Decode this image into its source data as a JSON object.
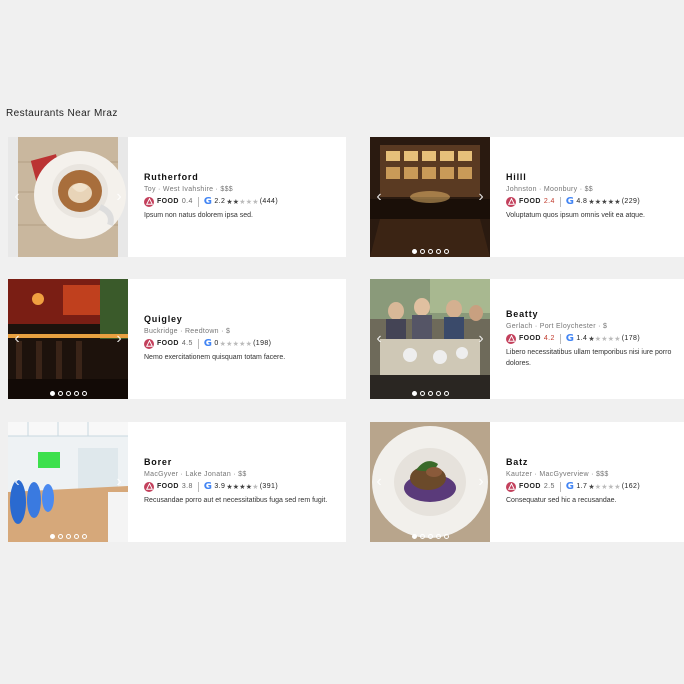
{
  "page": {
    "title": "Restaurants Near Mraz"
  },
  "brand": {
    "food_icon_color": "#c3405c",
    "google_blue": "#4285f4"
  },
  "restaurants": [
    {
      "name": "Rutherford",
      "meta": "Toy · West Ivahshire · $$$",
      "food_label": "FOOD",
      "food_score": "0.4",
      "food_score_style": "normal",
      "google_rating": "2.2",
      "stars": "★★",
      "stars_off": "★★★",
      "review_count": "(444)",
      "description": "Ipsum non natus dolorem ipsa sed.",
      "photo_count": 1,
      "active_photo": 0,
      "photo": "coffee-cup"
    },
    {
      "name": "Hilll",
      "meta": "Johnston · Moonbury · $$",
      "food_label": "FOOD",
      "food_score": "2.4",
      "food_score_style": "red",
      "google_rating": "4.8",
      "stars": "★★★★★",
      "stars_off": "",
      "review_count": "(229)",
      "description": "Voluptatum quos ipsum omnis velit ea atque.",
      "photo_count": 5,
      "active_photo": 0,
      "photo": "bar-interior"
    },
    {
      "name": "Quigley",
      "meta": "Buckridge · Reedtown · $",
      "food_label": "FOOD",
      "food_score": "4.5",
      "food_score_style": "normal",
      "google_rating": "0",
      "stars": "",
      "stars_off": "★★★★★",
      "review_count": "(198)",
      "description": "Nemo exercitationem quisquam totam facere.",
      "photo_count": 5,
      "active_photo": 0,
      "photo": "red-bar"
    },
    {
      "name": "Beatty",
      "meta": "Gerlach · Port Eloychester · $",
      "food_label": "FOOD",
      "food_score": "4.2",
      "food_score_style": "red",
      "google_rating": "1.4",
      "stars": "★",
      "stars_off": "★★★★",
      "review_count": "(178)",
      "description": "Libero necessitatibus ullam temporibus nisi iure porro dolores.",
      "photo_count": 5,
      "active_photo": 0,
      "photo": "family-table"
    },
    {
      "name": "Borer",
      "meta": "MacGyver · Lake Jonatan · $$",
      "food_label": "FOOD",
      "food_score": "3.8",
      "food_score_style": "normal",
      "google_rating": "3.9",
      "stars": "★★★★",
      "stars_off": "★",
      "review_count": "(391)",
      "description": "Recusandae porro aut et necessitatibus fuga sed rem fugit.",
      "photo_count": 5,
      "active_photo": 0,
      "photo": "white-lounge"
    },
    {
      "name": "Batz",
      "meta": "Kautzer · MacGyverview · $$$",
      "food_label": "FOOD",
      "food_score": "2.5",
      "food_score_style": "normal",
      "google_rating": "1.7",
      "stars": "★",
      "stars_off": "★★★★",
      "review_count": "(162)",
      "description": "Consequatur sed hic a recusandae.",
      "photo_count": 5,
      "active_photo": 0,
      "photo": "plated-dish"
    }
  ]
}
